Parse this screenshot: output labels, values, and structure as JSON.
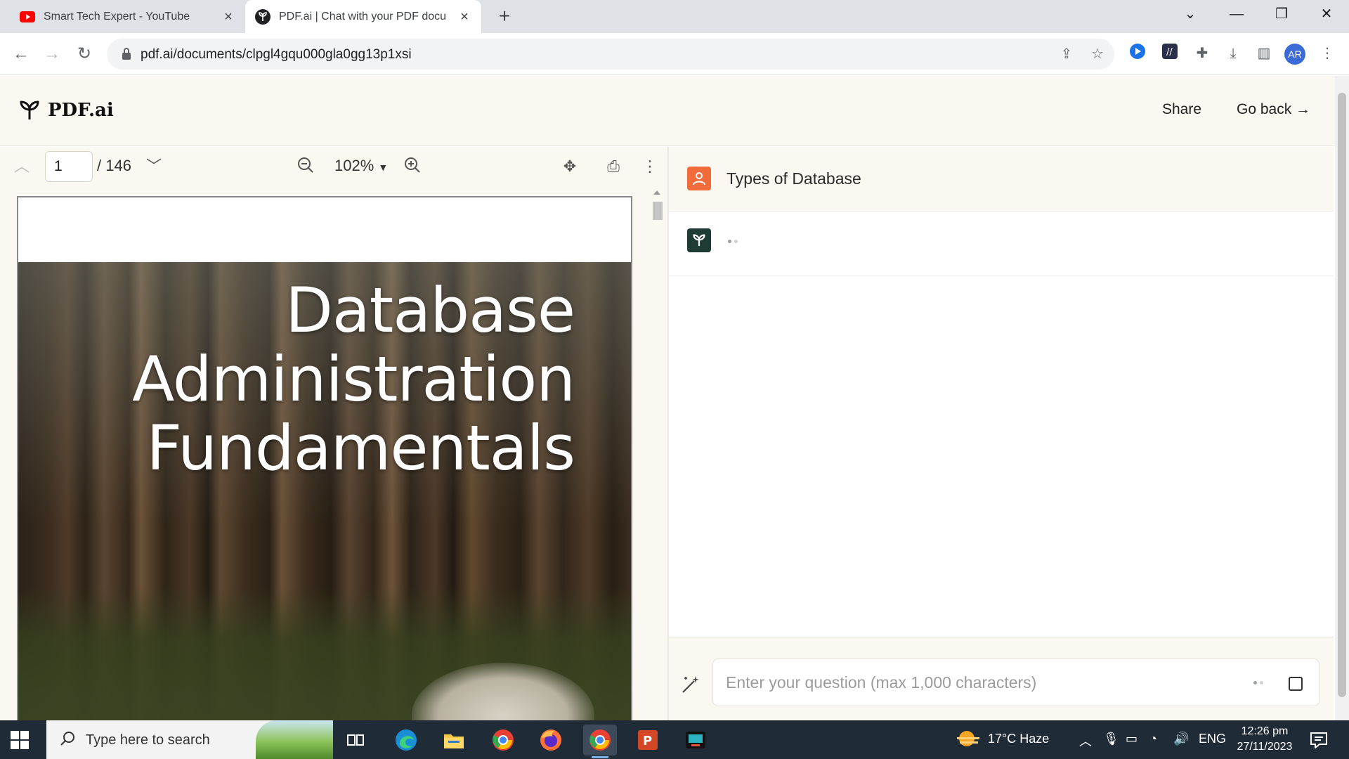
{
  "browser": {
    "tabs": [
      {
        "title": "Smart Tech Expert - YouTube",
        "favicon": "youtube-icon",
        "active": false
      },
      {
        "title": "PDF.ai | Chat with your PDF docu",
        "favicon": "pdfai-icon",
        "active": true
      }
    ],
    "url": "pdf.ai/documents/clpgl4gqu000gla0gg13p1xsi",
    "profile_initials": "AR"
  },
  "app": {
    "brand": "PDF.ai",
    "share_label": "Share",
    "go_back_label": "Go back →"
  },
  "pdf": {
    "current_page": "1",
    "total_pages": "/ 146",
    "zoom": "102%",
    "cover_lines": [
      "Database",
      "Administration",
      "Fundamentals"
    ]
  },
  "chat": {
    "user_message": "Types of Database",
    "input_placeholder": "Enter your question (max 1,000 characters)",
    "accent_color": "#f26b3a",
    "bot_avatar_color": "#1f3b36"
  },
  "taskbar": {
    "search_placeholder": "Type here to search",
    "weather": "17°C  Haze",
    "language": "ENG",
    "time": "12:26 pm",
    "date": "27/11/2023"
  }
}
